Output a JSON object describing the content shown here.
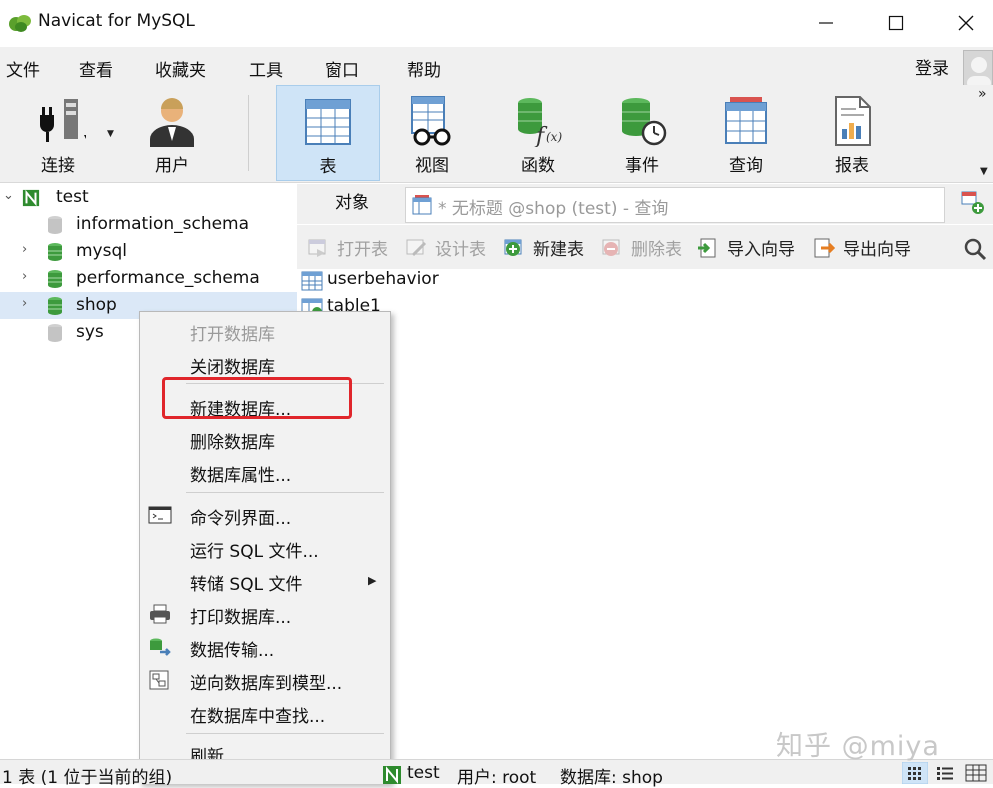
{
  "window": {
    "title": "Navicat for MySQL"
  },
  "menu": {
    "items": [
      "文件",
      "查看",
      "收藏夹",
      "工具",
      "窗口",
      "帮助"
    ],
    "login": "登录"
  },
  "toolbar": {
    "buttons": [
      "连接",
      "用户",
      "表",
      "视图",
      "函数",
      "事件",
      "查询",
      "报表"
    ],
    "active": "表"
  },
  "tree": {
    "connection": "test",
    "databases": [
      "information_schema",
      "mysql",
      "performance_schema",
      "shop",
      "sys"
    ],
    "selected": "shop"
  },
  "tabs": {
    "objects": "对象",
    "query": "* 无标题 @shop (test) - 查询"
  },
  "object_tools": [
    "打开表",
    "设计表",
    "新建表",
    "删除表",
    "导入向导",
    "导出向导"
  ],
  "objects": [
    "userbehavior",
    "table1"
  ],
  "context_menu": {
    "items": [
      "打开数据库",
      "关闭数据库",
      "新建数据库...",
      "删除数据库",
      "数据库属性...",
      "命令列界面...",
      "运行 SQL 文件...",
      "转储 SQL 文件",
      "打印数据库...",
      "数据传输...",
      "逆向数据库到模型...",
      "在数据库中查找...",
      "刷新"
    ],
    "highlighted": "新建数据库..."
  },
  "status": {
    "left": "1 表 (1 位于当前的组)",
    "connection": "test",
    "user": "用户: root",
    "database": "数据库: shop"
  },
  "watermark": "知乎 @miya",
  "colors": {
    "accent": "#cfe4f7",
    "highlight_box": "#e0262b",
    "db_green": "#3d9a3d"
  }
}
